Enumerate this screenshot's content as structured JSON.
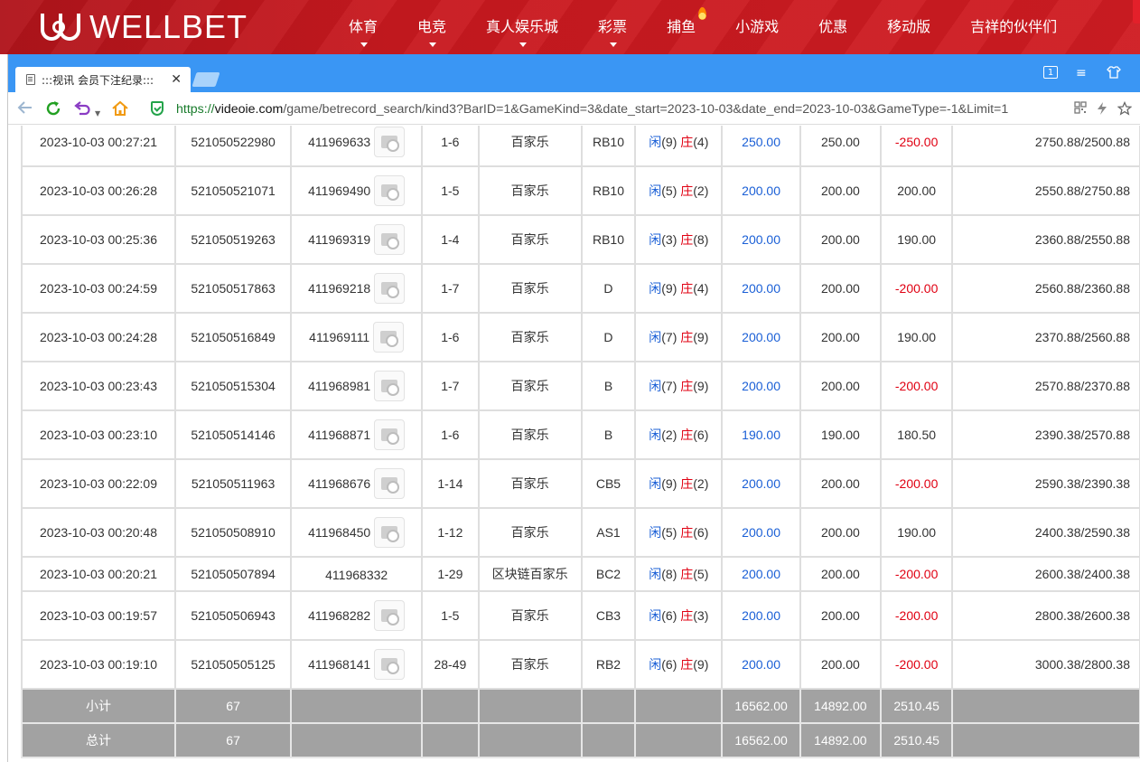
{
  "site": {
    "logo_text": "WELLBET",
    "nav": [
      {
        "label": "体育",
        "caret": true,
        "flame": false
      },
      {
        "label": "电竞",
        "caret": true,
        "flame": false
      },
      {
        "label": "真人娱乐城",
        "caret": true,
        "flame": false
      },
      {
        "label": "彩票",
        "caret": true,
        "flame": false
      },
      {
        "label": "捕鱼",
        "caret": false,
        "flame": true
      },
      {
        "label": "小游戏",
        "caret": false,
        "flame": false
      },
      {
        "label": "优惠",
        "caret": false,
        "flame": false
      },
      {
        "label": "移动版",
        "caret": false,
        "flame": false
      },
      {
        "label": "吉祥的伙伴们",
        "caret": false,
        "flame": false
      }
    ],
    "brand_color": "#c8191f"
  },
  "browser": {
    "tab_title": ":::视讯 会员下注纪录:::",
    "close_glyph": "✕",
    "url_scheme": "https://",
    "url_domain": "videoie.com",
    "url_path": "/game/betrecord_search/kind3?BarID=1&GameKind=3&date_start=2023-10-03&date_end=2023-10-03&GameType=-1&Limit=1",
    "window_controls": [
      "1",
      "≡",
      "⌂"
    ],
    "toolbar_icons": [
      "qr-code-icon",
      "bolt-icon",
      "star-icon"
    ],
    "accent": "#3a96f4"
  },
  "records": [
    {
      "time": "2023-10-03 00:27:21",
      "bet_no": "521050522980",
      "game_no": "411969633",
      "video": true,
      "round": "1-6",
      "game": "百家乐",
      "table": "RB10",
      "player": "9",
      "banker": "4",
      "bet": "250.00",
      "valid": "250.00",
      "result": "-250.00",
      "neg": true,
      "balance": "2750.88/2500.88"
    },
    {
      "time": "2023-10-03 00:26:28",
      "bet_no": "521050521071",
      "game_no": "411969490",
      "video": true,
      "round": "1-5",
      "game": "百家乐",
      "table": "RB10",
      "player": "5",
      "banker": "2",
      "bet": "200.00",
      "valid": "200.00",
      "result": "200.00",
      "neg": false,
      "balance": "2550.88/2750.88"
    },
    {
      "time": "2023-10-03 00:25:36",
      "bet_no": "521050519263",
      "game_no": "411969319",
      "video": true,
      "round": "1-4",
      "game": "百家乐",
      "table": "RB10",
      "player": "3",
      "banker": "8",
      "bet": "200.00",
      "valid": "200.00",
      "result": "190.00",
      "neg": false,
      "balance": "2360.88/2550.88"
    },
    {
      "time": "2023-10-03 00:24:59",
      "bet_no": "521050517863",
      "game_no": "411969218",
      "video": true,
      "round": "1-7",
      "game": "百家乐",
      "table": "D",
      "player": "9",
      "banker": "4",
      "bet": "200.00",
      "valid": "200.00",
      "result": "-200.00",
      "neg": true,
      "balance": "2560.88/2360.88"
    },
    {
      "time": "2023-10-03 00:24:28",
      "bet_no": "521050516849",
      "game_no": "411969111",
      "video": true,
      "round": "1-6",
      "game": "百家乐",
      "table": "D",
      "player": "7",
      "banker": "9",
      "bet": "200.00",
      "valid": "200.00",
      "result": "190.00",
      "neg": false,
      "balance": "2370.88/2560.88"
    },
    {
      "time": "2023-10-03 00:23:43",
      "bet_no": "521050515304",
      "game_no": "411968981",
      "video": true,
      "round": "1-7",
      "game": "百家乐",
      "table": "B",
      "player": "7",
      "banker": "9",
      "bet": "200.00",
      "valid": "200.00",
      "result": "-200.00",
      "neg": true,
      "balance": "2570.88/2370.88"
    },
    {
      "time": "2023-10-03 00:23:10",
      "bet_no": "521050514146",
      "game_no": "411968871",
      "video": true,
      "round": "1-6",
      "game": "百家乐",
      "table": "B",
      "player": "2",
      "banker": "6",
      "bet": "190.00",
      "valid": "190.00",
      "result": "180.50",
      "neg": false,
      "balance": "2390.38/2570.88"
    },
    {
      "time": "2023-10-03 00:22:09",
      "bet_no": "521050511963",
      "game_no": "411968676",
      "video": true,
      "round": "1-14",
      "game": "百家乐",
      "table": "CB5",
      "player": "9",
      "banker": "2",
      "bet": "200.00",
      "valid": "200.00",
      "result": "-200.00",
      "neg": true,
      "balance": "2590.38/2390.38"
    },
    {
      "time": "2023-10-03 00:20:48",
      "bet_no": "521050508910",
      "game_no": "411968450",
      "video": true,
      "round": "1-12",
      "game": "百家乐",
      "table": "AS1",
      "player": "5",
      "banker": "6",
      "bet": "200.00",
      "valid": "200.00",
      "result": "190.00",
      "neg": false,
      "balance": "2400.38/2590.38"
    },
    {
      "time": "2023-10-03 00:20:21",
      "bet_no": "521050507894",
      "game_no": "411968332",
      "video": false,
      "round": "1-29",
      "game": "区块链百家乐",
      "table": "BC2",
      "player": "8",
      "banker": "5",
      "bet": "200.00",
      "valid": "200.00",
      "result": "-200.00",
      "neg": true,
      "balance": "2600.38/2400.38"
    },
    {
      "time": "2023-10-03 00:19:57",
      "bet_no": "521050506943",
      "game_no": "411968282",
      "video": true,
      "round": "1-5",
      "game": "百家乐",
      "table": "CB3",
      "player": "6",
      "banker": "3",
      "bet": "200.00",
      "valid": "200.00",
      "result": "-200.00",
      "neg": true,
      "balance": "2800.38/2600.38"
    },
    {
      "time": "2023-10-03 00:19:10",
      "bet_no": "521050505125",
      "game_no": "411968141",
      "video": true,
      "round": "28-49",
      "game": "百家乐",
      "table": "RB2",
      "player": "6",
      "banker": "9",
      "bet": "200.00",
      "valid": "200.00",
      "result": "-200.00",
      "neg": true,
      "balance": "3000.38/2800.38"
    }
  ],
  "labels": {
    "player": "闲",
    "banker": "庄"
  },
  "subtotal": {
    "label": "小计",
    "count": "67",
    "bet": "16562.00",
    "valid": "14892.00",
    "result": "2510.45"
  },
  "total": {
    "label": "总计",
    "count": "67",
    "bet": "16562.00",
    "valid": "14892.00",
    "result": "2510.45"
  }
}
